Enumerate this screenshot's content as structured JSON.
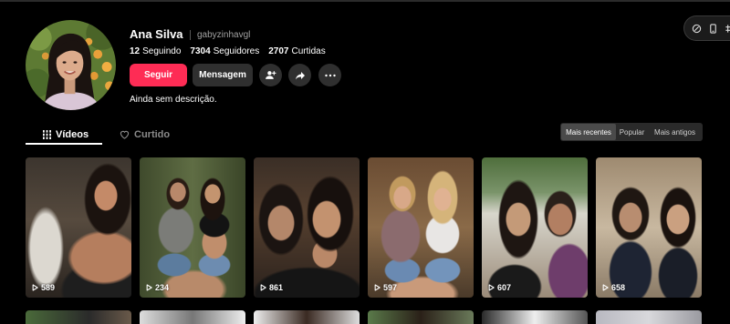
{
  "profile": {
    "name": "Ana Silva",
    "username": "gabyzinhavgl",
    "stats": [
      {
        "value": "12",
        "label": "Seguindo"
      },
      {
        "value": "7304",
        "label": "Seguidores"
      },
      {
        "value": "2707",
        "label": "Curtidas"
      }
    ],
    "bio": "Ainda sem descrição."
  },
  "actions": {
    "follow_label": "Seguir",
    "message_label": "Mensagem",
    "icons": [
      "add-user-icon",
      "share-icon",
      "more-icon"
    ]
  },
  "toolbar": {
    "icons": [
      "circle-slash-icon",
      "phone-icon",
      "hash-icon"
    ]
  },
  "tabs": [
    {
      "label": "Vídeos",
      "icon": "grid-icon",
      "active": true
    },
    {
      "label": "Curtido",
      "icon": "heart-icon",
      "active": false
    }
  ],
  "sort": {
    "options": [
      {
        "label": "Mais recentes",
        "active": true
      },
      {
        "label": "Popular",
        "active": false
      },
      {
        "label": "Mais antigos",
        "active": false
      }
    ]
  },
  "videos": [
    {
      "views": "589"
    },
    {
      "views": "234"
    },
    {
      "views": "861"
    },
    {
      "views": "597"
    },
    {
      "views": "607"
    },
    {
      "views": "658"
    }
  ],
  "colors": {
    "background": "#000000",
    "accent": "#fe2c55",
    "button_secondary": "#2f2f2f",
    "text_secondary": "#a1a1a1"
  }
}
